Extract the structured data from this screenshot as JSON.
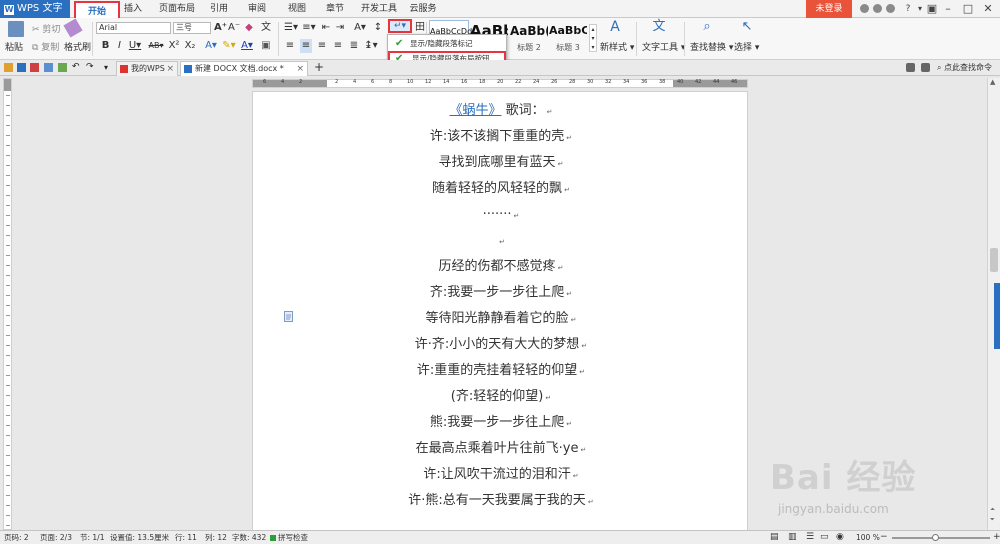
{
  "menubar": {
    "app_name": "WPS 文字",
    "tabs": [
      "开始",
      "插入",
      "页面布局",
      "引用",
      "审阅",
      "视图",
      "章节",
      "开发工具",
      "云服务"
    ],
    "login_label": "未登录"
  },
  "ribbon": {
    "paste_label": "粘贴",
    "cut_label": "剪切",
    "copy_label": "复制",
    "format_painter_label": "格式刷",
    "font_name": "Arial",
    "font_size": "三号",
    "styles": [
      {
        "sample": "AaBbCcDd",
        "name": ""
      },
      {
        "sample": "AaBb",
        "name": ""
      },
      {
        "sample": "AaBb(",
        "name": "标题 2"
      },
      {
        "sample": "AaBbC",
        "name": "标题 3"
      }
    ],
    "new_style_label": "新样式",
    "text_tools_label": "文字工具",
    "find_replace_label": "查找替换",
    "select_label": "选择"
  },
  "popup": {
    "items": [
      "显示/隐藏段落标记",
      "显示/隐藏段落布局按钮"
    ]
  },
  "tabbar": {
    "tabs": [
      {
        "label": "我的WPS"
      },
      {
        "label": "新建 DOCX 文档.docx *"
      }
    ],
    "add_label": "+",
    "search_command_label": "点此查找命令"
  },
  "ruler_numbers": [
    "6",
    "4",
    "2",
    "",
    "2",
    "4",
    "6",
    "8",
    "10",
    "12",
    "14",
    "16",
    "18",
    "20",
    "22",
    "24",
    "26",
    "28",
    "30",
    "32",
    "34",
    "36",
    "38",
    "40",
    "42",
    "44",
    "46"
  ],
  "document": {
    "title_link": "《蜗牛》",
    "title_rest": "歌词：",
    "lines": [
      "许:该不该搁下重重的壳",
      "寻找到底哪里有蓝天",
      "随着轻轻的风轻轻的飘",
      "·······",
      "",
      "历经的伤都不感觉疼",
      "齐:我要一步一步往上爬",
      "等待阳光静静看着它的脸",
      "许·齐:小小的天有大大的梦想",
      "许:重重的壳挂着轻轻的仰望",
      "(齐:轻轻的仰望)",
      "熊:我要一步一步往上爬",
      "在最高点乘着叶片往前飞·ye",
      "许:让风吹干流过的泪和汗",
      "许·熊:总有一天我要属于我的天"
    ],
    "para_mark": "↵"
  },
  "statusbar": {
    "page_no": "页码: 2",
    "pages": "页面: 2/3",
    "section": "节: 1/1",
    "setting": "设置值: 13.5厘米",
    "row": "行: 11",
    "col": "列: 12",
    "words": "字数: 432",
    "spell": "拼写检查",
    "zoom": "100 %"
  },
  "watermark": {
    "text": "Bai 经验",
    "sub": "jingyan.baidu.com"
  },
  "colors": {
    "accent": "#2a6fc0",
    "highlight_box": "#e8343d",
    "login": "#e8533a",
    "check": "#2d9c3c"
  }
}
